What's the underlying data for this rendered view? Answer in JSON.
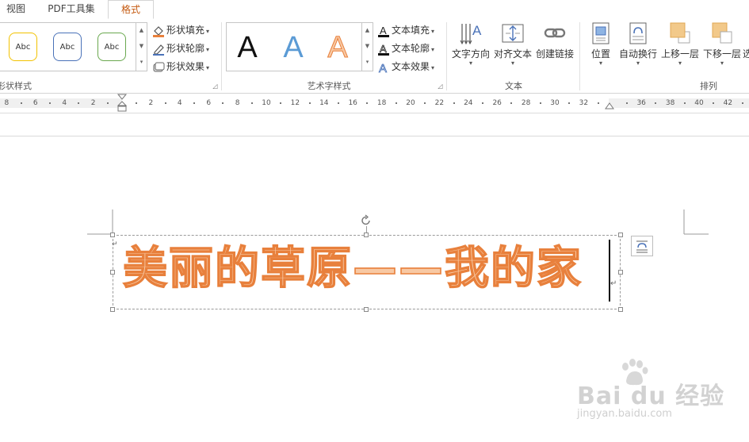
{
  "tabs": [
    {
      "label": "视图",
      "active": false
    },
    {
      "label": "PDF工具集",
      "active": false
    },
    {
      "label": "格式",
      "active": true
    }
  ],
  "ribbon": {
    "shape_styles": {
      "group_label": "形状样式",
      "gallery": [
        "Abc",
        "Abc",
        "Abc"
      ],
      "gallery_colors": [
        "#f2c200",
        "#4a72b8",
        "#6aa84f"
      ],
      "fill": "形状填充",
      "outline": "形状轮廓",
      "effects": "形状效果"
    },
    "wordart_styles": {
      "group_label": "艺术字样式",
      "gallery": [
        "A",
        "A",
        "A"
      ],
      "text_fill": "文本填充",
      "text_outline": "文本轮廓",
      "text_effects": "文本效果"
    },
    "text_group": {
      "group_label": "文本",
      "direction": "文字方向",
      "align": "对齐文本",
      "link": "创建链接"
    },
    "arrange": {
      "group_label": "排列",
      "position": "位置",
      "wrap": "自动换行",
      "bring_forward": "上移一层",
      "send_backward": "下移一层",
      "select_partial": "选"
    }
  },
  "ruler": {
    "labels": [
      "8",
      "6",
      "4",
      "2",
      "2",
      "4",
      "6",
      "8",
      "10",
      "12",
      "14",
      "16",
      "18",
      "20",
      "22",
      "24",
      "26",
      "28",
      "30",
      "32",
      "36",
      "38",
      "40",
      "42"
    ]
  },
  "document": {
    "wordart_text": "美丽的草原——我的家",
    "fill_color": "#f8c9a4",
    "outline_color": "#e8803c"
  },
  "watermark": {
    "brand": "Bai du 经验",
    "url": "jingyan.baidu.com"
  }
}
